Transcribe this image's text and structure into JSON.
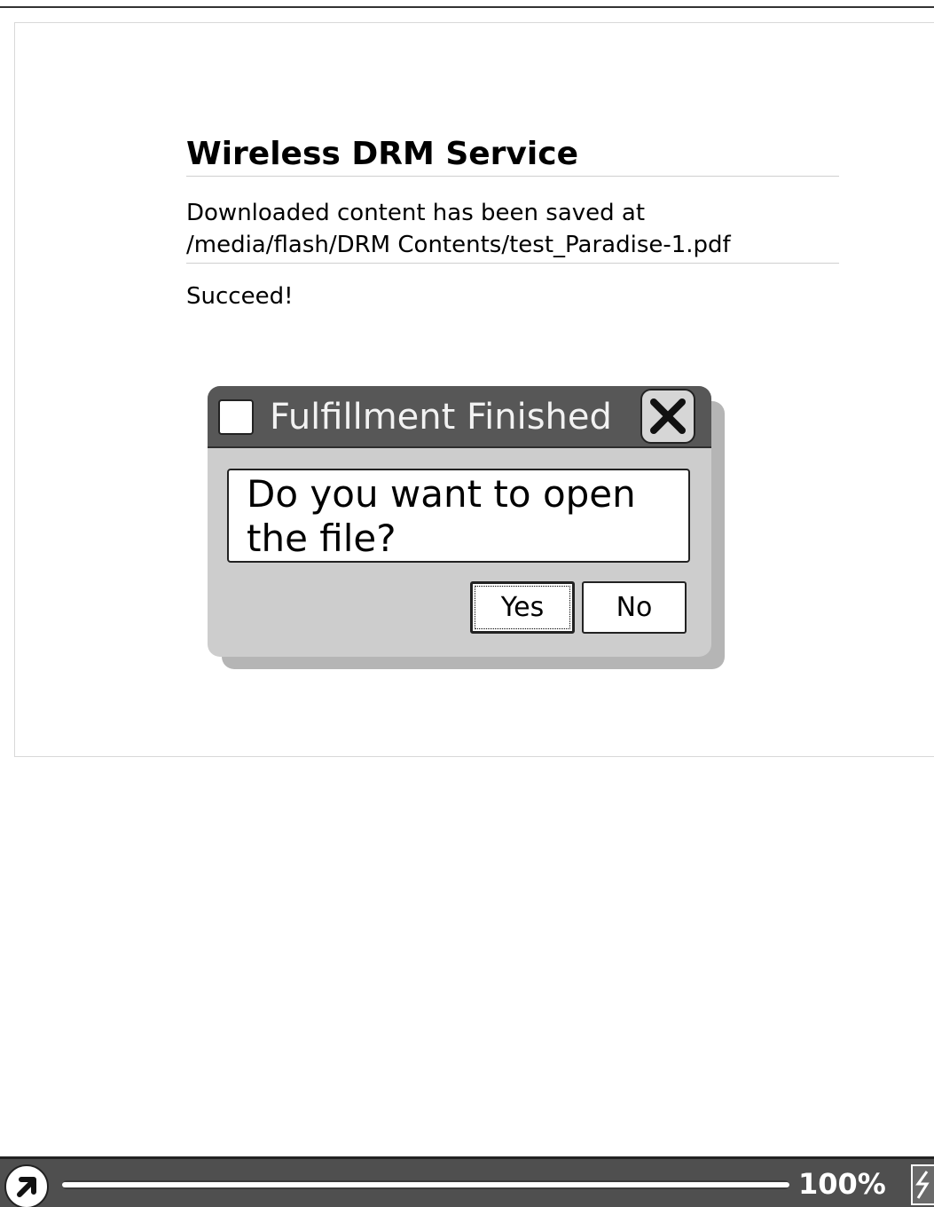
{
  "page": {
    "title": "Wireless DRM Service",
    "message_lines": [
      "Downloaded content has been saved at",
      "/media/flash/DRM Contents/test_Paradise-1.pdf"
    ],
    "status": "Succeed!"
  },
  "dialog": {
    "title": "Fulfillment Finished",
    "close_icon": "close-x-icon",
    "message_lines": [
      "Do you want to open",
      "the file?"
    ],
    "buttons": {
      "yes": "Yes",
      "no": "No"
    },
    "focused_button": "Yes"
  },
  "statusbar": {
    "home_icon": "arrow-up-right-icon",
    "progress_fraction": 1.0,
    "percent_label": "100%",
    "battery_icon": "battery-charging-icon"
  },
  "colors": {
    "titlebar": "#575757",
    "dialog_body": "#cdcdcd",
    "statusbar": "#4f4f4f"
  }
}
